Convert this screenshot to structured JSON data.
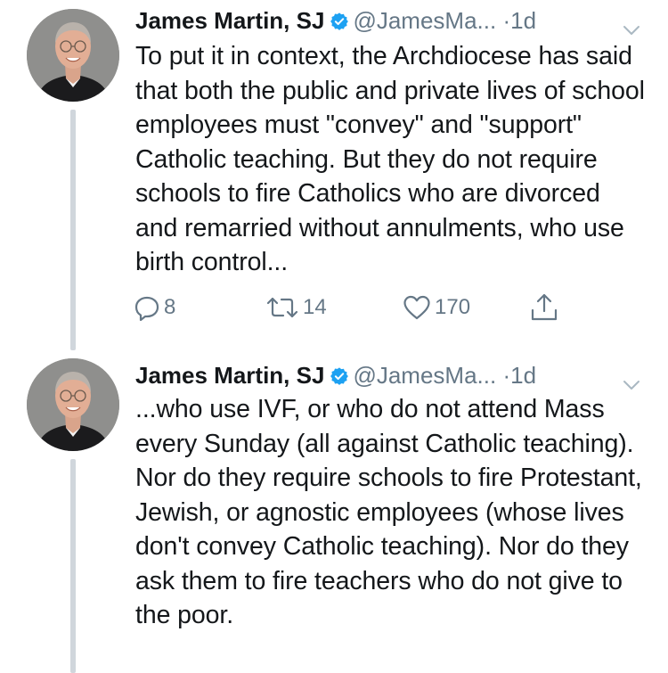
{
  "tweets": [
    {
      "author_name": "James Martin, SJ",
      "handle": "@JamesMa...",
      "separator": "·",
      "time": "1d",
      "text": "To put it in context, the Archdiocese has said that both the public and private lives of school employees must \"convey\" and \"support\" Catholic teaching. But they do not require schools to fire Catholics who are divorced and remarried without annulments, who use birth control...",
      "reply_count": "8",
      "retweet_count": "14",
      "like_count": "170"
    },
    {
      "author_name": "James Martin, SJ",
      "handle": "@JamesMa...",
      "separator": "·",
      "time": "1d",
      "text": "...who use IVF, or who do not attend Mass every Sunday (all against Catholic teaching). Nor do they require schools to fire Protestant, Jewish, or agnostic employees (whose lives don't convey Catholic teaching). Nor do they ask them to fire teachers who do not give to the poor."
    }
  ],
  "icons": {
    "verified": "verified-badge-icon",
    "menu": "chevron-down-icon",
    "reply": "reply-icon",
    "retweet": "retweet-icon",
    "like": "heart-icon",
    "share": "share-icon"
  },
  "colors": {
    "text": "#14171a",
    "secondary": "#657786",
    "verified": "#1da1f2",
    "thread_line": "#d0d6dc"
  }
}
